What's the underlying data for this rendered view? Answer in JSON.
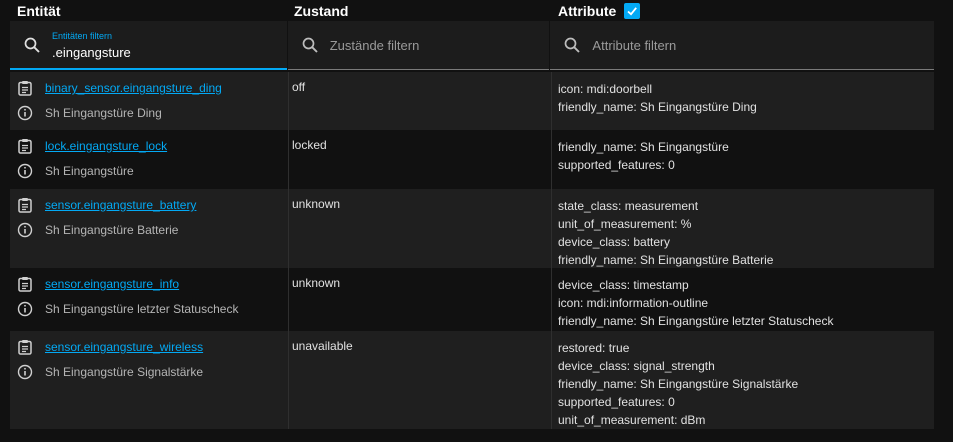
{
  "headers": {
    "entity": "Entität",
    "state": "Zustand",
    "attributes": "Attribute"
  },
  "filters": {
    "entity_label": "Entitäten filtern",
    "entity_value": ".eingangsture",
    "state_placeholder": "Zustände filtern",
    "attributes_placeholder": "Attribute filtern"
  },
  "colors": {
    "accent": "#03a9f4",
    "background": "#111111",
    "row_alt": "#1f1f1f"
  },
  "rows": [
    {
      "entity_id": "binary_sensor.eingangsture_ding",
      "name": "Sh Eingangstüre Ding",
      "state": "off",
      "attributes": [
        "icon: mdi:doorbell",
        "friendly_name: Sh Eingangstüre Ding"
      ]
    },
    {
      "entity_id": "lock.eingangsture_lock",
      "name": "Sh Eingangstüre",
      "state": "locked",
      "attributes": [
        "friendly_name: Sh Eingangstüre",
        "supported_features: 0"
      ]
    },
    {
      "entity_id": "sensor.eingangsture_battery",
      "name": "Sh Eingangstüre Batterie",
      "state": "unknown",
      "attributes": [
        "state_class: measurement",
        "unit_of_measurement: %",
        "device_class: battery",
        "friendly_name: Sh Eingangstüre Batterie"
      ]
    },
    {
      "entity_id": "sensor.eingangsture_info",
      "name": "Sh Eingangstüre letzter Statuscheck",
      "state": "unknown",
      "attributes": [
        "device_class: timestamp",
        "icon: mdi:information-outline",
        "friendly_name: Sh Eingangstüre letzter Statuscheck"
      ]
    },
    {
      "entity_id": "sensor.eingangsture_wireless",
      "name": "Sh Eingangstüre Signalstärke",
      "state": "unavailable",
      "attributes": [
        "restored: true",
        "device_class: signal_strength",
        "friendly_name: Sh Eingangstüre Signalstärke",
        "supported_features: 0",
        "unit_of_measurement: dBm"
      ]
    }
  ]
}
